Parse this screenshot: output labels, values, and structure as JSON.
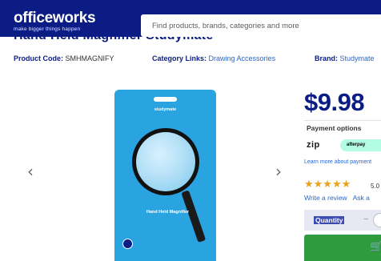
{
  "header": {
    "logo": "officeworks",
    "tagline": "make bigger things happen",
    "search_placeholder": "Find products, brands, categories and more"
  },
  "product_meta": {
    "code_label": "Product Code:",
    "code_value": "SMHMAGNIFY",
    "category_label": "Category Links:",
    "category_value": "Drawing Accessories",
    "brand_label": "Brand:",
    "brand_value": "Studymate"
  },
  "gallery": {
    "prev_icon": "‹",
    "next_icon": "›",
    "packaging_brand": "studymate",
    "packaging_title": "Hand Held Magnifier"
  },
  "purchase": {
    "price": "$9.98",
    "payment_title": "Payment options",
    "zip_label": "zip",
    "afterpay_label": "afterpay",
    "learn_more": "Learn more about payment",
    "rating": "5.0",
    "stars": "★★★★★",
    "write_review": "Write a review",
    "ask_question": "Ask a",
    "quantity_label": "Quantity",
    "qty_minus": "−"
  },
  "colors": {
    "brand_navy": "#0b1d85",
    "add_to_cart_green": "#2f9b3f",
    "link_blue": "#2d66c9",
    "star_orange": "#e8a21e"
  }
}
